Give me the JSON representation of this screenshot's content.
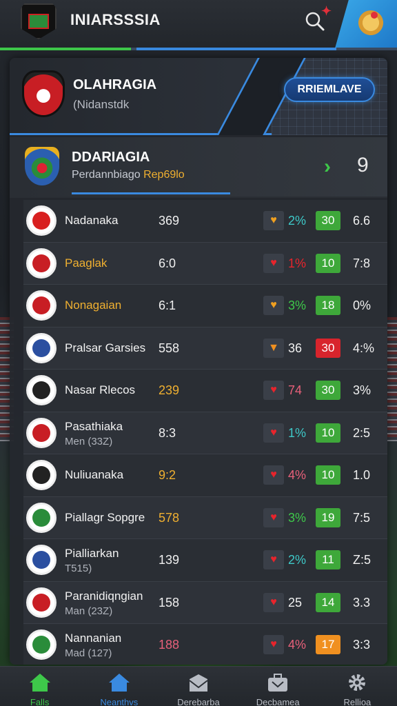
{
  "header": {
    "app_title": "INIARSSSIA",
    "notif_mark": "✦"
  },
  "banner": {
    "title": "OLAHRAGIA",
    "subtitle": "(Nidanstdk",
    "cta_label": "RRIEMLAVE"
  },
  "feature": {
    "title": "DDARIAGIA",
    "subtitle": "Perdannbiago",
    "highlight": "Rep69lo",
    "count": "9"
  },
  "rows": [
    {
      "name": "Nadanaka",
      "sub": "",
      "score": "369",
      "score_color": "#f0f0f0",
      "react": "♥",
      "react_color": "#f0a020",
      "pct": "2%",
      "pct_color": "#3ec8c8",
      "badge": "30",
      "badge_color": "#3ea83a",
      "val": "6.6",
      "crest_color": "#d82020"
    },
    {
      "name": "Paaglak",
      "sub": "",
      "score": "6:0",
      "score_color": "#f0f0f0",
      "react": "♥",
      "react_color": "#e8242c",
      "pct": "1%",
      "pct_color": "#e8242c",
      "badge": "10",
      "badge_color": "#3ea83a",
      "val": "7:8",
      "crest_color": "#c81e24",
      "name_color": "#f0b030"
    },
    {
      "name": "Nonagaian",
      "sub": "",
      "score": "6:1",
      "score_color": "#f0f0f0",
      "react": "♥",
      "react_color": "#f0a020",
      "pct": "3%",
      "pct_color": "#3ec84a",
      "badge": "18",
      "badge_color": "#3ea83a",
      "val": "0%",
      "crest_color": "#c81e24",
      "name_color": "#f0b030"
    },
    {
      "name": "Pralsar Garsies",
      "sub": "",
      "score": "558",
      "score_color": "#f0f0f0",
      "react": "▼",
      "react_color": "#f09020",
      "pct": "36",
      "pct_color": "#f0f0f0",
      "badge": "30",
      "badge_color": "#d8242c",
      "val": "4:%",
      "crest_color": "#2b4fa0"
    },
    {
      "name": "Nasar Rlecos",
      "sub": "",
      "score": "239",
      "score_color": "#f0b030",
      "react": "♥",
      "react_color": "#e8242c",
      "pct": "74",
      "pct_color": "#e8607a",
      "badge": "30",
      "badge_color": "#3ea83a",
      "val": "3%",
      "crest_color": "#222222"
    },
    {
      "name": "Pasathiaka",
      "sub": "Men (33Z)",
      "score": "8:3",
      "score_color": "#f0f0f0",
      "react": "♥",
      "react_color": "#e8242c",
      "pct": "1%",
      "pct_color": "#3ec8c8",
      "badge": "10",
      "badge_color": "#3ea83a",
      "val": "2:5",
      "crest_color": "#c81e24"
    },
    {
      "name": "Nuliuanaka",
      "sub": "",
      "score": "9:2",
      "score_color": "#f0b030",
      "react": "♥",
      "react_color": "#e8242c",
      "pct": "4%",
      "pct_color": "#e8607a",
      "badge": "10",
      "badge_color": "#3ea83a",
      "val": "1.0",
      "crest_color": "#222222"
    },
    {
      "name": "Piallagr Sopgre",
      "sub": "",
      "score": "578",
      "score_color": "#f0b030",
      "react": "♥",
      "react_color": "#e8242c",
      "pct": "3%",
      "pct_color": "#3ec84a",
      "badge": "19",
      "badge_color": "#3ea83a",
      "val": "7:5",
      "crest_color": "#2a8c3a"
    },
    {
      "name": "Pialliarkan",
      "sub": "T515)",
      "score": "139",
      "score_color": "#f0f0f0",
      "react": "♥",
      "react_color": "#e8242c",
      "pct": "2%",
      "pct_color": "#3ec8c8",
      "badge": "11",
      "badge_color": "#3ea83a",
      "val": "Z:5",
      "crest_color": "#2b4fa0"
    },
    {
      "name": "Paranidiqngian",
      "sub": "Man (23Z)",
      "score": "158",
      "score_color": "#f0f0f0",
      "react": "♥",
      "react_color": "#e8242c",
      "pct": "25",
      "pct_color": "#f0f0f0",
      "badge": "14",
      "badge_color": "#3ea83a",
      "val": "3.3",
      "crest_color": "#c81e24"
    },
    {
      "name": "Nannanian",
      "sub": "Mad (127)",
      "score": "188",
      "score_color": "#e8607a",
      "react": "♥",
      "react_color": "#e8242c",
      "pct": "4%",
      "pct_color": "#e8607a",
      "badge": "17",
      "badge_color": "#f09020",
      "val": "3:3",
      "crest_color": "#2a8c3a"
    }
  ],
  "nav": [
    {
      "label": "Falls",
      "icon": "home-icon",
      "color": "green"
    },
    {
      "label": "Neanthvs",
      "icon": "home-icon",
      "color": "blue"
    },
    {
      "label": "Derebarba",
      "icon": "inbox-icon",
      "color": ""
    },
    {
      "label": "Decbamea",
      "icon": "briefcase-icon",
      "color": ""
    },
    {
      "label": "Rellioa",
      "icon": "gear-icon",
      "color": ""
    }
  ]
}
